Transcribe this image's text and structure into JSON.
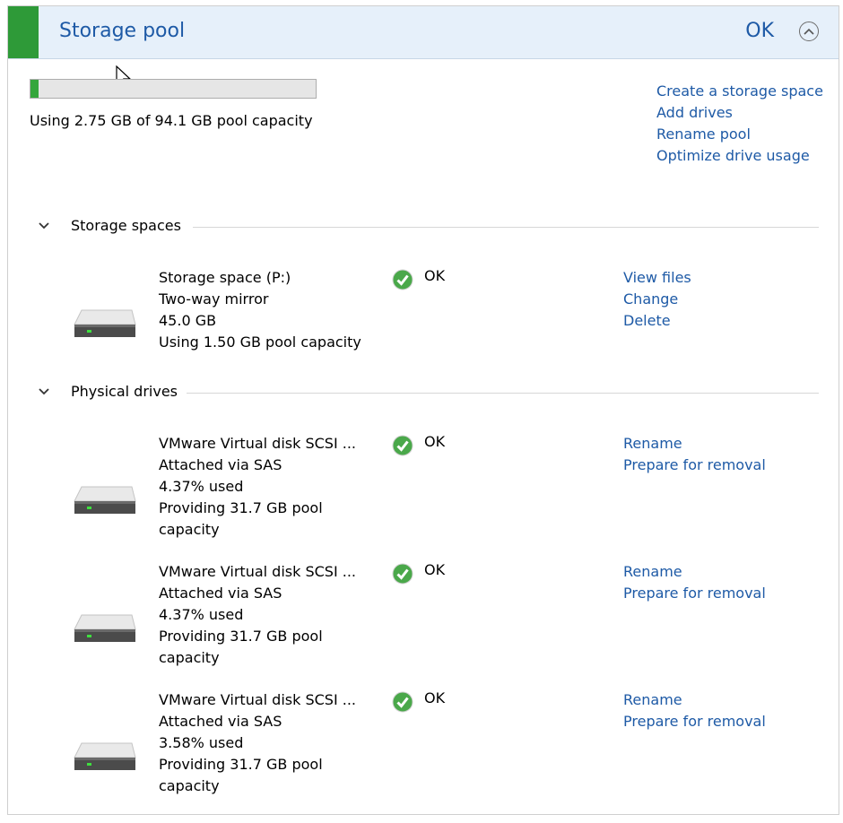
{
  "header": {
    "title": "Storage pool",
    "status": "OK"
  },
  "capacity": {
    "used_fraction": 0.029,
    "text": "Using 2.75 GB of 94.1 GB pool capacity",
    "bar_color": "#35a63c"
  },
  "pool_actions": [
    "Create a storage space",
    "Add drives",
    "Rename pool",
    "Optimize drive usage"
  ],
  "storage_spaces": {
    "title": "Storage spaces",
    "items": [
      {
        "lines": [
          "Storage space (P:)",
          "Two-way mirror",
          "45.0 GB",
          "Using 1.50 GB pool capacity"
        ],
        "status": "OK",
        "actions": [
          "View files",
          "Change",
          "Delete"
        ]
      }
    ]
  },
  "physical_drives": {
    "title": "Physical drives",
    "items": [
      {
        "lines": [
          "VMware Virtual disk SCSI ...",
          "Attached via SAS",
          "4.37% used",
          "Providing 31.7 GB pool",
          "capacity"
        ],
        "status": "OK",
        "actions": [
          "Rename",
          "Prepare for removal"
        ]
      },
      {
        "lines": [
          "VMware Virtual disk SCSI ...",
          "Attached via SAS",
          "4.37% used",
          "Providing 31.7 GB pool",
          "capacity"
        ],
        "status": "OK",
        "actions": [
          "Rename",
          "Prepare for removal"
        ]
      },
      {
        "lines": [
          "VMware Virtual disk SCSI ...",
          "Attached via SAS",
          "3.58% used",
          "Providing 31.7 GB pool",
          "capacity"
        ],
        "status": "OK",
        "actions": [
          "Rename",
          "Prepare for removal"
        ]
      }
    ]
  },
  "colors": {
    "accent": "#2e9a38",
    "link": "#1e5aa6",
    "header_bg": "#e6f0fa",
    "ok_green": "#4aa84a"
  }
}
